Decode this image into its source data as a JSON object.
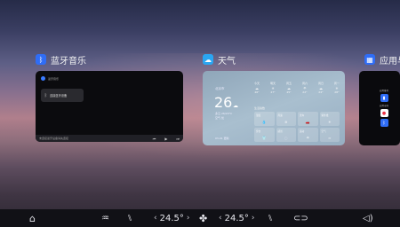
{
  "cards": {
    "music": {
      "title": "蓝牙音乐",
      "icon": "bluetooth-icon",
      "accent": "#2f6df6",
      "status": "蓝牙音乐",
      "connect_label": "连接蓝牙设备",
      "song": "未连接蓝牙设备请先连接",
      "controls": [
        "⏮",
        "▶",
        "⏭"
      ]
    },
    "weather": {
      "title": "天气",
      "icon": "weather-icon",
      "accent": "#2aa6f2",
      "city": "北京市",
      "temp": "26",
      "sub1": "多云 26/20°C",
      "sub2": "空气 优",
      "foot": "03-01 更新",
      "forecast": [
        {
          "day": "今天",
          "icon": "☁",
          "temp": "26°"
        },
        {
          "day": "明天",
          "icon": "☀",
          "temp": "27°"
        },
        {
          "day": "周五",
          "icon": "☁",
          "temp": "25°"
        },
        {
          "day": "周六",
          "icon": "☂",
          "temp": "22°"
        },
        {
          "day": "周日",
          "icon": "☁",
          "temp": "24°"
        },
        {
          "day": "周一",
          "icon": "☀",
          "temp": "28°"
        }
      ],
      "details_header": "生活指数",
      "tiles": [
        {
          "label": "湿度",
          "icon": "💧"
        },
        {
          "label": "风速",
          "icon": "≋"
        },
        {
          "label": "洗车",
          "icon": "🚗"
        },
        {
          "label": "紫外线",
          "icon": "☀"
        },
        {
          "label": "穿衣",
          "icon": "👕"
        },
        {
          "label": "感冒",
          "icon": "◌"
        },
        {
          "label": "运动",
          "icon": "☂"
        },
        {
          "label": "空气",
          "icon": "≈"
        }
      ]
    },
    "apps": {
      "title": "应用与",
      "icon": "app-market-icon",
      "accent": "#2f6df6",
      "labels": [
        "应用推荐",
        "应用市场"
      ],
      "mini_colors": [
        "#2f6df6",
        "#ffffff",
        "#2f6df6"
      ]
    }
  },
  "dock": {
    "home_icon": "home-icon",
    "defrost_icon": "defrost-icon",
    "seat_icon": "seat-icon",
    "left_temp": "24.5°",
    "fan_icon": "fan-icon",
    "right_temp": "24.5°",
    "seat_right_icon": "seat-right-icon",
    "car_icon": "car-icon",
    "volume_icon": "volume-icon",
    "chev_left": "‹",
    "chev_right": "›"
  }
}
